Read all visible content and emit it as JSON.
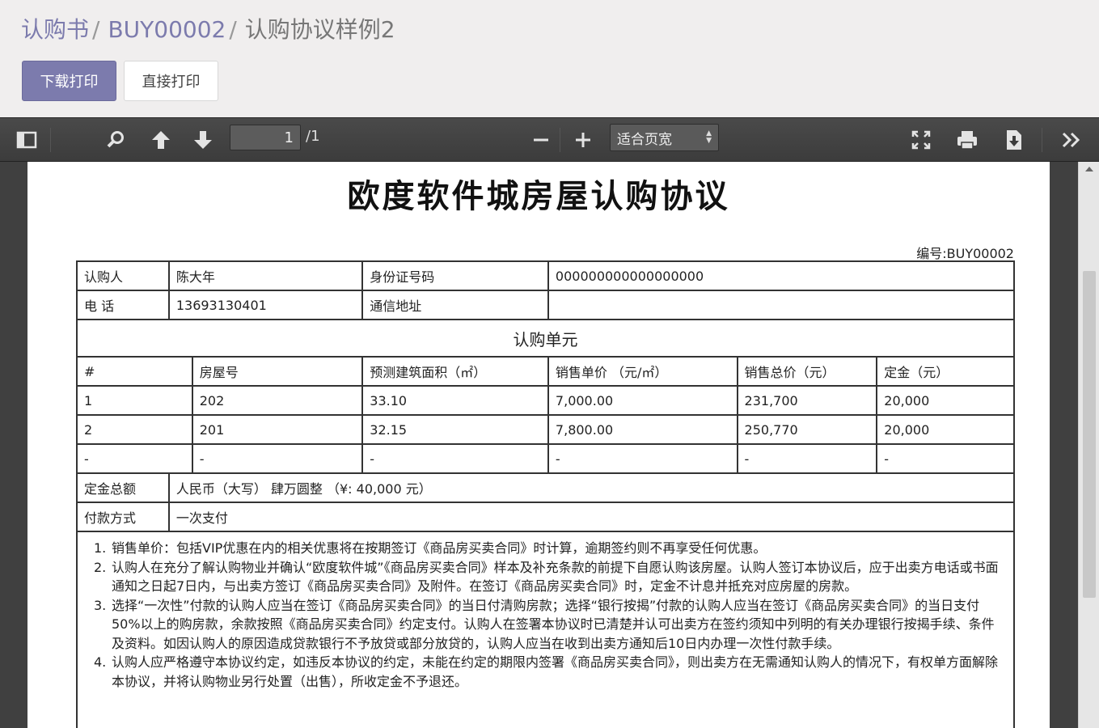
{
  "breadcrumb": {
    "items": [
      "认购书",
      "BUY00002"
    ],
    "separator": "/",
    "current": "认购协议样例2"
  },
  "buttons": {
    "download_print": "下载打印",
    "direct_print": "直接打印"
  },
  "pdf_toolbar": {
    "page_number": "1",
    "page_total": "/1",
    "zoom_label": "适合页宽",
    "icons": [
      "sidebar-toggle-icon",
      "search-icon",
      "previous-page-icon",
      "next-page-icon",
      "zoom-out-icon",
      "zoom-in-icon",
      "presentation-mode-icon",
      "print-icon",
      "download-icon",
      "tools-icon"
    ]
  },
  "document": {
    "title": "欧度软件城房屋认购协议",
    "number_label": "编号:BUY00002",
    "buyer_label": "认购人",
    "buyer_name": "陈大年",
    "id_label": "身份证号码",
    "id_value": "000000000000000000",
    "phone_label": "电 话",
    "phone_value": "13693130401",
    "address_label": "通信地址",
    "address_value": "",
    "unit_section": "认购单元",
    "unit_headers": [
      "#",
      "房屋号",
      "预测建筑面积（㎡）",
      "销售单价 （元/㎡）",
      "销售总价（元）",
      "定金（元）"
    ],
    "unit_rows": [
      [
        "1",
        "202",
        "33.10",
        "7,000.00",
        "231,700",
        "20,000"
      ],
      [
        "2",
        "201",
        "32.15",
        "7,800.00",
        "250,770",
        "20,000"
      ],
      [
        "-",
        "-",
        "-",
        "-",
        "-",
        "-"
      ]
    ],
    "deposit_label": "定金总额",
    "deposit_value": "人民币（大写） 肆万圆整 （¥: 40,000 元）",
    "payment_label": "付款方式",
    "payment_value": "一次支付",
    "terms": [
      {
        "num": "1.",
        "text": "销售单价：包括VIP优惠在内的相关优惠将在按期签订《商品房买卖合同》时计算，逾期签约则不再享受任何优惠。"
      },
      {
        "num": "2.",
        "text": "认购人在充分了解认购物业并确认“欧度软件城”《商品房买卖合同》样本及补充条款的前提下自愿认购该房屋。认购人签订本协议后，应于出卖方电话或书面通知之日起7日内，与出卖方签订《商品房买卖合同》及附件。在签订《商品房买卖合同》时，定金不计息并抵充对应房屋的房款。"
      },
      {
        "num": "3.",
        "text": "选择“一次性”付款的认购人应当在签订《商品房买卖合同》的当日付清购房款；选择“银行按揭”付款的认购人应当在签订《商品房买卖合同》的当日支付50%以上的购房款，余款按照《商品房买卖合同》约定支付。认购人在签署本协议时已清楚并认可出卖方在签约须知中列明的有关办理银行按揭手续、条件及资料。如因认购人的原因造成贷款银行不予放贷或部分放贷的，认购人应当在收到出卖方通知后10日内办理一次性付款手续。"
      },
      {
        "num": "4.",
        "text": "认购人应严格遵守本协议约定，如违反本协议的约定，未能在约定的期限内签署《商品房买卖合同》，则出卖方在无需通知认购人的情况下，有权单方面解除本协议，并将认购物业另行处置（出售），所收定金不予退还。"
      }
    ]
  },
  "colors": {
    "accent": "#7c7bad",
    "toolbar": "#404040",
    "viewer_bg": "#404040"
  }
}
